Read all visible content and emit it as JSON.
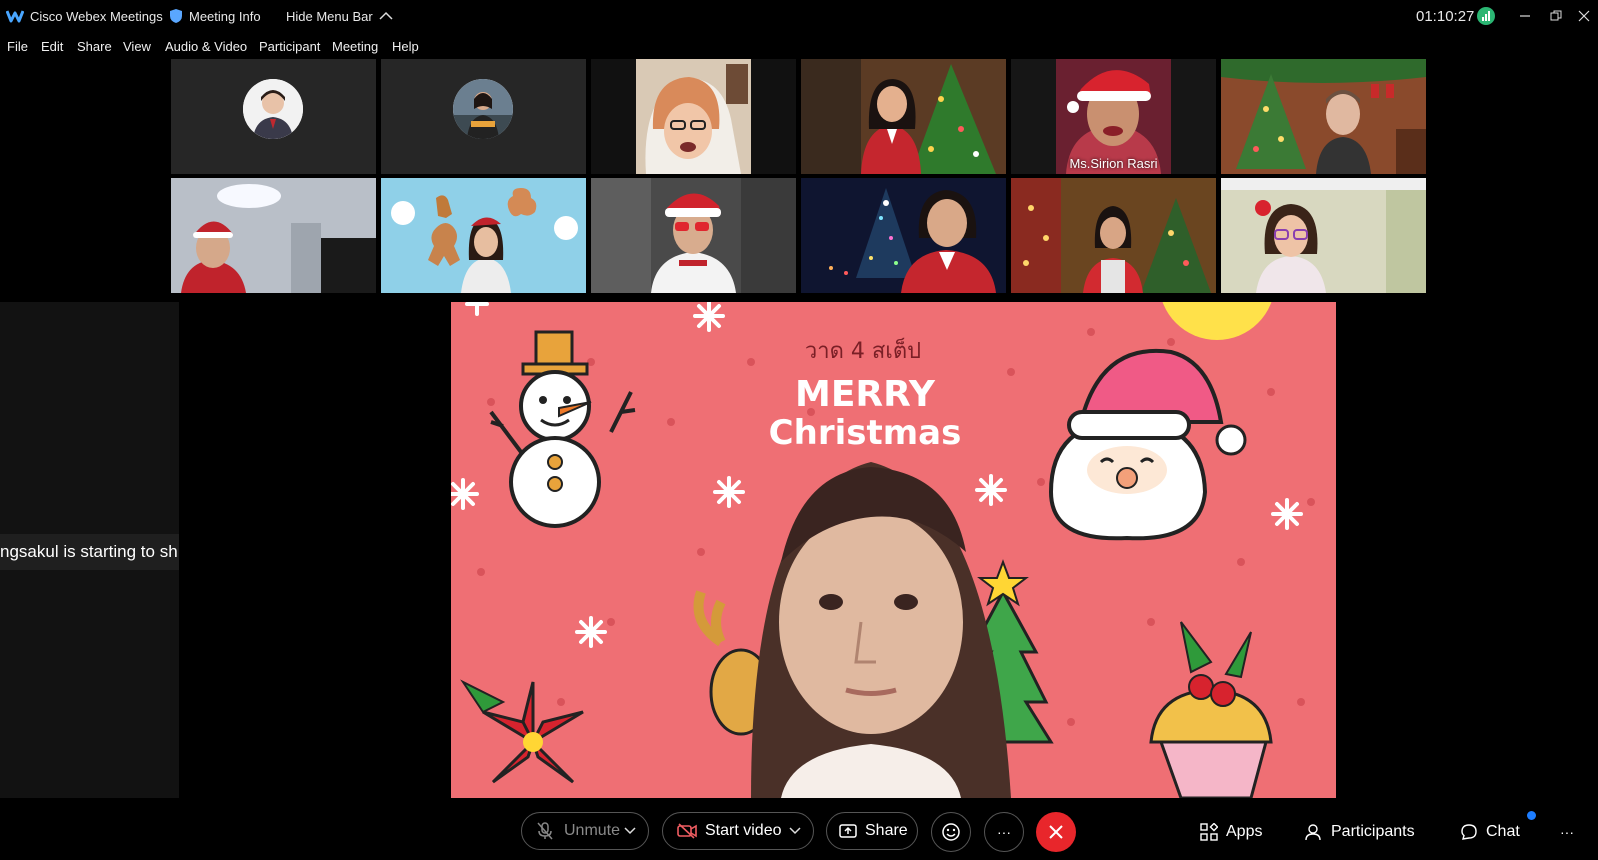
{
  "window": {
    "app_name": "Cisco Webex Meetings",
    "meeting_info": "Meeting Info",
    "hide_menu_bar": "Hide Menu Bar",
    "timer": "01:10:27",
    "accent": "#2ea3f2"
  },
  "menu": [
    "File",
    "Edit",
    "Share",
    "View",
    "Audio & Video",
    "Participant",
    "Meeting",
    "Help"
  ],
  "participants": {
    "active_speaker_name": "Ms.Sirion Rasri"
  },
  "shared_content": {
    "thai_caption": "วาด 4 สเต็ป",
    "greeting_line1": "MERRY",
    "greeting_line2": "Christmas"
  },
  "notification": {
    "text": "ngsakul is starting to sh"
  },
  "controls": {
    "unmute": "Unmute",
    "start_video": "Start video",
    "share": "Share",
    "apps": "Apps",
    "participants": "Participants",
    "chat": "Chat",
    "more": "···",
    "end_color": "#e8262b"
  }
}
